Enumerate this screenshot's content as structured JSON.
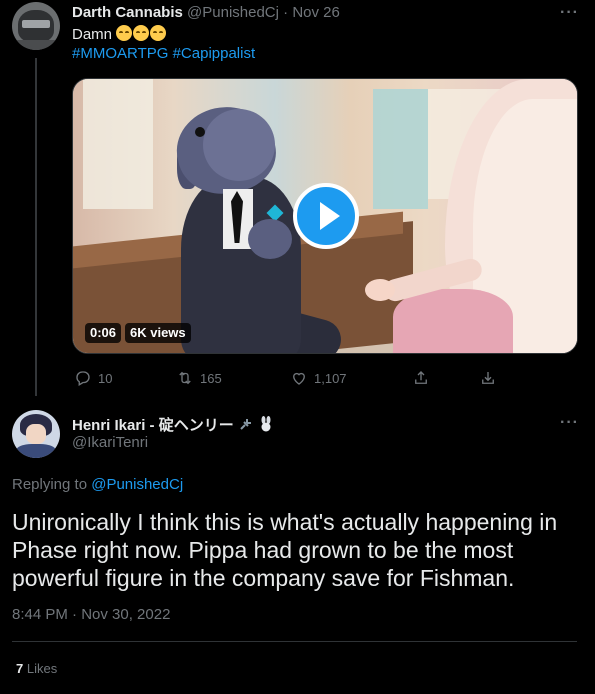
{
  "tweet1": {
    "author_name": "Darth Cannabis",
    "handle": "@PunishedCj",
    "separator": "·",
    "date": "Nov 26",
    "text": "Damn",
    "hashtags": [
      "#MMOARTPG",
      "#Capippalist"
    ],
    "more_label": "···",
    "video": {
      "duration": "0:06",
      "views": "6K views"
    },
    "actions": {
      "replies": "10",
      "retweets": "165",
      "likes": "1,107"
    }
  },
  "tweet2": {
    "author_name": "Henri Ikari - 碇ヘンリー",
    "handle": "@IkariTenri",
    "more_label": "···",
    "replying_prefix": "Replying to",
    "replying_handle": "@PunishedCj",
    "body": "Unironically I think this is what's actually happening in Phase right now. Pippa had grown to be the most powerful figure in the company save for Fishman.",
    "timestamp": "8:44 PM · Nov 30, 2022",
    "likes_count": "7",
    "likes_label": "Likes"
  },
  "colors": {
    "background": "#000000",
    "text": "#e7e9ea",
    "muted": "#71767b",
    "accent": "#1d9bf0"
  },
  "icons": [
    "reply-icon",
    "retweet-icon",
    "like-icon",
    "share-icon",
    "download-icon",
    "play-icon",
    "more-icon"
  ]
}
